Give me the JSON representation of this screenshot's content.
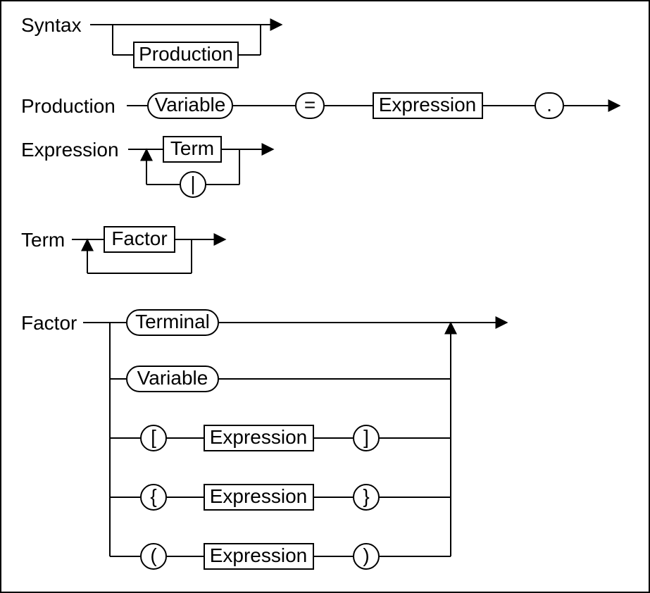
{
  "rules": {
    "syntax": {
      "name": "Syntax",
      "body": "Production"
    },
    "production": {
      "name": "Production",
      "var": "Variable",
      "eq": "=",
      "expr": "Expression",
      "dot": "."
    },
    "expression": {
      "name": "Expression",
      "term": "Term",
      "sep": "|"
    },
    "term": {
      "name": "Term",
      "body": "Factor"
    },
    "factor": {
      "name": "Factor",
      "alt1": "Terminal",
      "alt2": "Variable",
      "alt3": {
        "open": "[",
        "body": "Expression",
        "close": "]"
      },
      "alt4": {
        "open": "{",
        "body": "Expression",
        "close": "}"
      },
      "alt5": {
        "open": "(",
        "body": "Expression",
        "close": ")"
      }
    }
  }
}
